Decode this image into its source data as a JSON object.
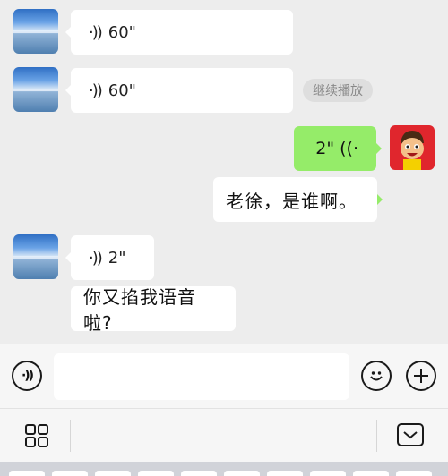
{
  "messages": [
    {
      "side": "left",
      "type": "voice",
      "duration": "60\""
    },
    {
      "side": "left",
      "type": "voice",
      "duration": "60\"",
      "badge": "继续播放"
    },
    {
      "side": "right",
      "type": "voice",
      "duration": "2\""
    },
    {
      "side": "right",
      "type": "text",
      "text": "老徐，是谁啊。"
    },
    {
      "side": "left",
      "type": "voice",
      "duration": "2\""
    },
    {
      "side": "left",
      "type": "text",
      "text": "你又掐我语音啦?"
    }
  ],
  "input": {
    "placeholder": "",
    "value": ""
  },
  "icons": {
    "voice_toggle": "voice-input-icon",
    "emoji": "emoji-icon",
    "plus": "plus-icon",
    "apps": "apps-grid-icon",
    "collapse": "keyboard-collapse-icon"
  },
  "colors": {
    "sent_bubble": "#95ec69",
    "received_bubble": "#ffffff",
    "background": "#ededed",
    "avatar_right": "#e0262d"
  }
}
